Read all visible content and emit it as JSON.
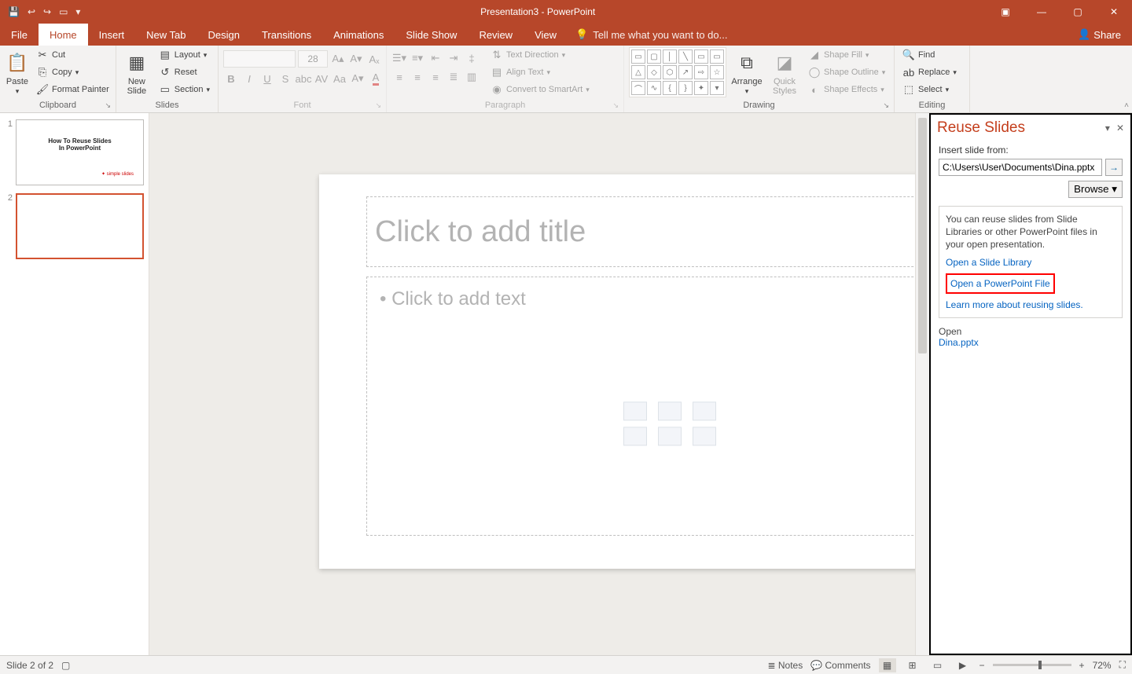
{
  "title": "Presentation3 - PowerPoint",
  "tabs": {
    "file": "File",
    "home": "Home",
    "insert": "Insert",
    "newtab": "New Tab",
    "design": "Design",
    "transitions": "Transitions",
    "animations": "Animations",
    "slideshow": "Slide Show",
    "review": "Review",
    "view": "View"
  },
  "tellme": "Tell me what you want to do...",
  "share": "Share",
  "clipboard": {
    "paste": "Paste",
    "cut": "Cut",
    "copy": "Copy",
    "formatpainter": "Format Painter",
    "label": "Clipboard"
  },
  "slides": {
    "newslide": "New\nSlide",
    "layout": "Layout",
    "reset": "Reset",
    "section": "Section",
    "label": "Slides"
  },
  "font": {
    "name": "",
    "size": "28",
    "label": "Font"
  },
  "paragraph": {
    "textdir": "Text Direction",
    "align": "Align Text",
    "smartart": "Convert to SmartArt",
    "label": "Paragraph"
  },
  "drawing": {
    "arrange": "Arrange",
    "quickstyles": "Quick\nStyles",
    "fill": "Shape Fill",
    "outline": "Shape Outline",
    "effects": "Shape Effects",
    "label": "Drawing"
  },
  "editing": {
    "find": "Find",
    "replace": "Replace",
    "select": "Select",
    "label": "Editing"
  },
  "thumbs": {
    "s1_line1": "How To Reuse Slides",
    "s1_line2": "In PowerPoint",
    "s1_brand": "✦ simple slides"
  },
  "placeholder": {
    "title": "Click to add title",
    "body": "• Click to add text"
  },
  "pane": {
    "title": "Reuse Slides",
    "insertfrom": "Insert slide from:",
    "path": "C:\\Users\\User\\Documents\\Dina.pptx",
    "browse": "Browse",
    "help": "You can reuse slides from Slide Libraries or other PowerPoint files in your open presentation.",
    "link1": "Open a Slide Library",
    "link2": "Open a PowerPoint File",
    "link3": "Learn more about reusing slides.",
    "open_hdr": "Open",
    "open_file": "Dina.pptx"
  },
  "status": {
    "slide": "Slide 2 of 2",
    "notes": "Notes",
    "comments": "Comments",
    "zoom": "72%"
  }
}
